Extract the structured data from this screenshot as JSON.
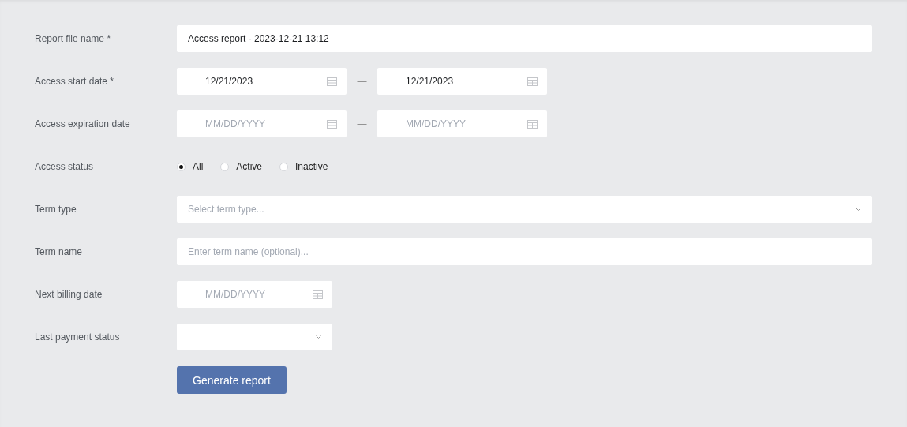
{
  "fields": [
    {
      "kind": "text",
      "label": "Report file name *",
      "value": "Access report - 2023-12-21 13:12"
    },
    {
      "kind": "daterange",
      "label": "Access start date *",
      "from": {
        "value": "12/21/2023"
      },
      "to": {
        "value": "12/21/2023"
      },
      "separator": "—"
    },
    {
      "kind": "daterange",
      "label": "Access expiration date",
      "from": {
        "placeholder": "MM/DD/YYYY"
      },
      "to": {
        "placeholder": "MM/DD/YYYY"
      },
      "separator": "—"
    },
    {
      "kind": "radio",
      "label": "Access status",
      "options": [
        {
          "label": "All",
          "selected": true
        },
        {
          "label": "Active",
          "selected": false
        },
        {
          "label": "Inactive",
          "selected": false
        }
      ]
    },
    {
      "kind": "select",
      "label": "Term type",
      "placeholder": "Select term type...",
      "wide": true
    },
    {
      "kind": "text",
      "label": "Term name",
      "placeholder": "Enter term name (optional)..."
    },
    {
      "kind": "date",
      "label": "Next billing date",
      "placeholder": "MM/DD/YYYY"
    },
    {
      "kind": "select",
      "label": "Last payment status",
      "wide": false
    }
  ],
  "button": "Generate report"
}
